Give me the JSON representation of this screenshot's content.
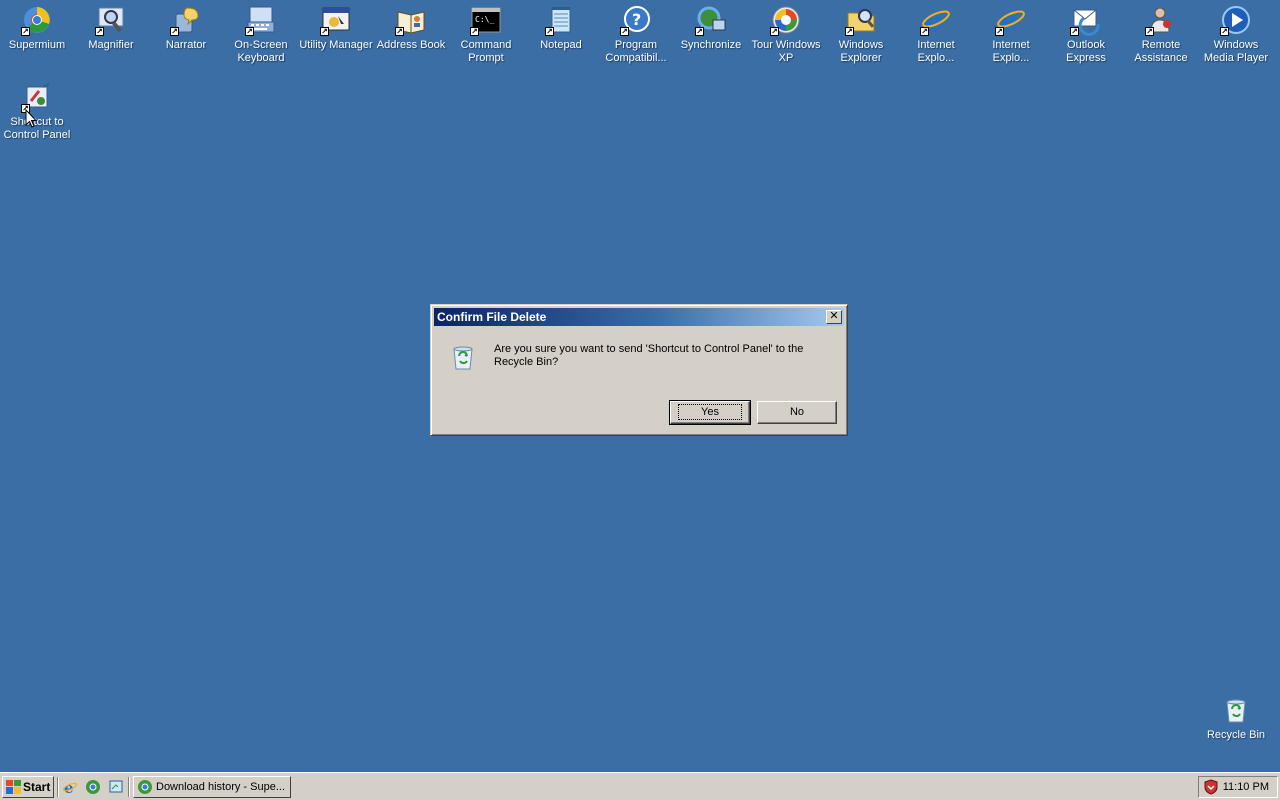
{
  "desktop": {
    "icons": [
      {
        "label": "Supermium",
        "icon": "supermium-icon"
      },
      {
        "label": "Magnifier",
        "icon": "magnifier-icon"
      },
      {
        "label": "Narrator",
        "icon": "narrator-icon"
      },
      {
        "label": "On-Screen Keyboard",
        "icon": "keyboard-icon"
      },
      {
        "label": "Utility Manager",
        "icon": "utility-manager-icon"
      },
      {
        "label": "Address Book",
        "icon": "address-book-icon"
      },
      {
        "label": "Command Prompt",
        "icon": "command-prompt-icon"
      },
      {
        "label": "Notepad",
        "icon": "notepad-icon"
      },
      {
        "label": "Program Compatibil...",
        "icon": "help-icon"
      },
      {
        "label": "Synchronize",
        "icon": "synchronize-icon"
      },
      {
        "label": "Tour Windows XP",
        "icon": "tour-icon"
      },
      {
        "label": "Windows Explorer",
        "icon": "folder-icon"
      },
      {
        "label": "Internet Explo...",
        "icon": "internet-explorer-icon"
      },
      {
        "label": "Internet Explo...",
        "icon": "internet-explorer-icon"
      },
      {
        "label": "Outlook Express",
        "icon": "outlook-express-icon"
      },
      {
        "label": "Remote Assistance",
        "icon": "remote-assistance-icon"
      },
      {
        "label": "Windows Media Player",
        "icon": "media-player-icon"
      }
    ],
    "control_panel_shortcut": {
      "label": "Shortcut to Control Panel",
      "icon": "control-panel-icon"
    },
    "recycle_bin": {
      "label": "Recycle Bin",
      "icon": "recycle-bin-icon"
    }
  },
  "dialog": {
    "title": "Confirm File Delete",
    "close_label": "✕",
    "message": "Are you sure you want to send 'Shortcut to Control Panel' to the Recycle Bin?",
    "yes_label": "Yes",
    "no_label": "No"
  },
  "taskbar": {
    "start_label": "Start",
    "task_button_label": "Download history - Supe...",
    "clock": "11:10 PM"
  },
  "colors": {
    "desktop": "#3a6ea5",
    "titlebar_start": "#0a246a",
    "titlebar_end": "#a6caf0",
    "face": "#d4d0c8"
  }
}
